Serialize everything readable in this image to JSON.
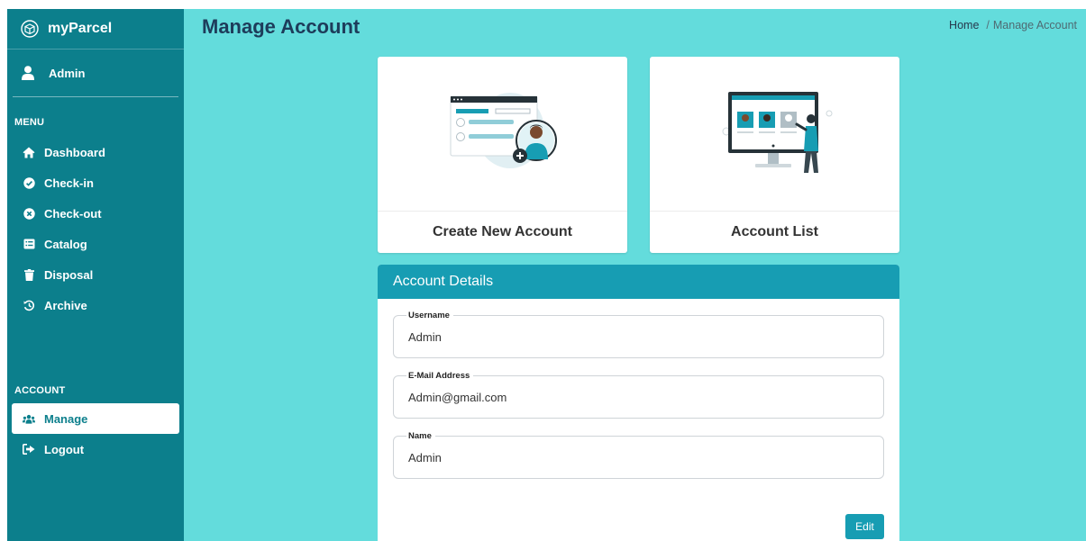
{
  "sidebar": {
    "brand": "myParcel",
    "user": "Admin",
    "menu_label": "MENU",
    "items": [
      {
        "label": "Dashboard",
        "icon": "home-icon"
      },
      {
        "label": "Check-in",
        "icon": "check-circle-icon"
      },
      {
        "label": "Check-out",
        "icon": "x-circle-icon"
      },
      {
        "label": "Catalog",
        "icon": "list-icon"
      },
      {
        "label": "Disposal",
        "icon": "trash-icon"
      },
      {
        "label": "Archive",
        "icon": "history-icon"
      }
    ],
    "account_label": "ACCOUNT",
    "account_items": [
      {
        "label": "Manage",
        "icon": "users-icon",
        "active": true
      },
      {
        "label": "Logout",
        "icon": "logout-icon"
      }
    ]
  },
  "header": {
    "title": "Manage Account",
    "breadcrumb": {
      "home": "Home",
      "separator": "/",
      "current": "Manage Account"
    }
  },
  "cards": [
    {
      "title": "Create New Account"
    },
    {
      "title": "Account List"
    }
  ],
  "details": {
    "title": "Account Details",
    "fields": [
      {
        "label": "Username",
        "value": "Admin"
      },
      {
        "label": "E-Mail Address",
        "value": "Admin@gmail.com"
      },
      {
        "label": "Name",
        "value": "Admin"
      }
    ],
    "edit_label": "Edit"
  },
  "colors": {
    "sidebar": "#0c7f8c",
    "background": "#63dcdc",
    "accent": "#179db3",
    "title": "#1d3c5a"
  }
}
